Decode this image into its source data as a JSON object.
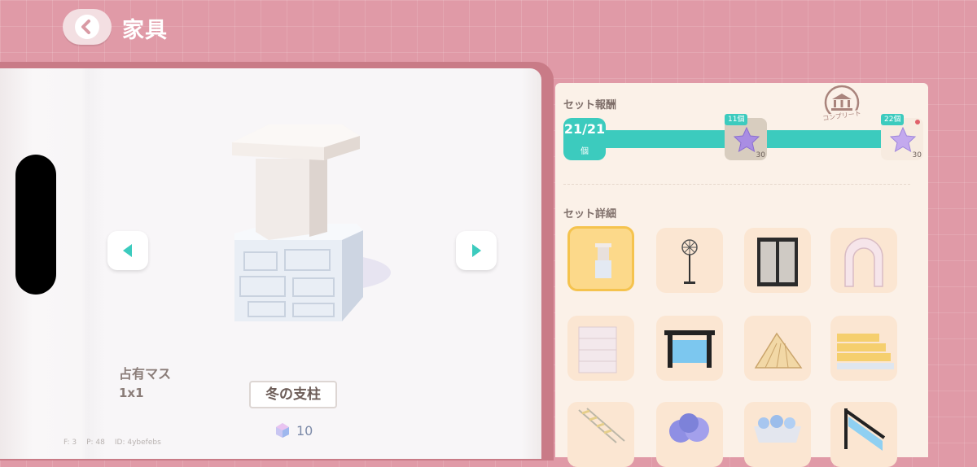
{
  "header": {
    "title": "家具",
    "back_icon": "chevron-left-icon"
  },
  "item": {
    "size_label": "占有マス",
    "size_value": "1x1",
    "name": "冬の支柱",
    "owned_count": "10",
    "count_icon": "gem-cube-icon"
  },
  "debug": {
    "f": "F: 3",
    "p": "P: 48",
    "id": "ID: 4ybefebs"
  },
  "set_rewards": {
    "label": "セット報酬",
    "complete_badge": "コンプリート",
    "progress": {
      "count": "21/21",
      "unit": "個",
      "fraction": 1.0
    },
    "rewards": [
      {
        "threshold": "11個",
        "amount": "30",
        "icon": "purple-star-icon",
        "claimed": true
      },
      {
        "threshold": "22個",
        "amount": "30",
        "icon": "purple-star-icon",
        "claimed": false
      }
    ]
  },
  "set_details": {
    "label": "セット詳細",
    "items": [
      {
        "name": "winter-pillar",
        "selected": true
      },
      {
        "name": "snowflake-lamp"
      },
      {
        "name": "dark-window"
      },
      {
        "name": "stone-arch"
      },
      {
        "name": "white-wall-block"
      },
      {
        "name": "glass-fence"
      },
      {
        "name": "wooden-roof"
      },
      {
        "name": "wooden-steps"
      },
      {
        "name": "ladder-stairs"
      },
      {
        "name": "blue-flower-bush"
      },
      {
        "name": "flower-planter"
      },
      {
        "name": "railing"
      }
    ]
  },
  "colors": {
    "accent": "#3ccbbe",
    "background": "#e09aa7",
    "panel": "#fbf1e8"
  }
}
